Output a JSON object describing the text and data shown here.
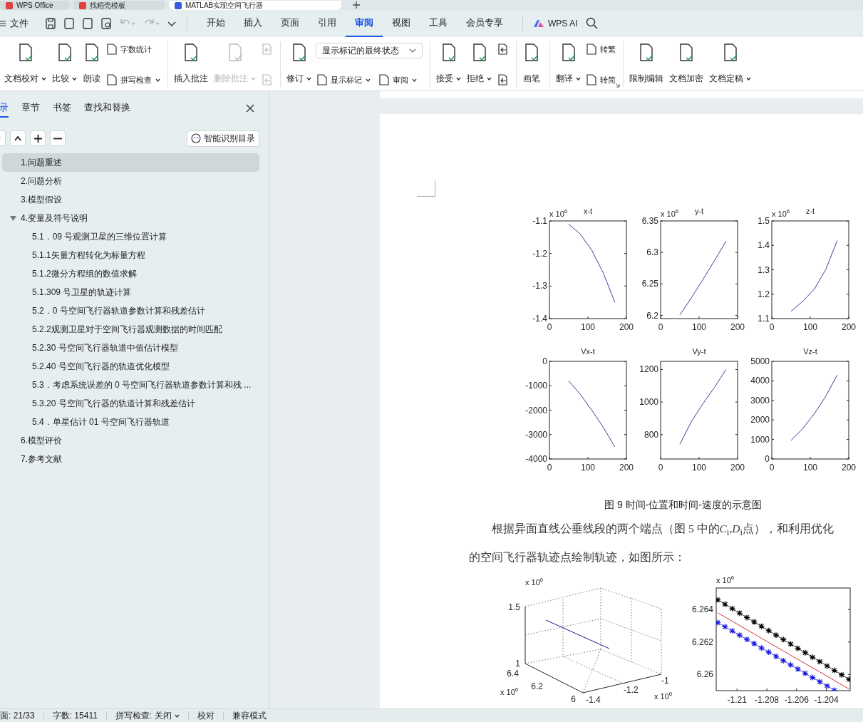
{
  "browser_tabs": [
    {
      "label": "WPS Office",
      "selected": false
    },
    {
      "label": "找稻壳模板",
      "selected": false
    },
    {
      "label": "MATLAB实现空间飞行器",
      "selected": true
    }
  ],
  "menu": {
    "file": "文件",
    "tabs": [
      {
        "label": "开始",
        "selected": false
      },
      {
        "label": "插入",
        "selected": false
      },
      {
        "label": "页面",
        "selected": false
      },
      {
        "label": "引用",
        "selected": false
      },
      {
        "label": "审阅",
        "selected": true
      },
      {
        "label": "视图",
        "selected": false
      },
      {
        "label": "工具",
        "selected": false
      },
      {
        "label": "会员专享",
        "selected": false
      }
    ],
    "ai": "WPS AI"
  },
  "ribbon": {
    "groups": [
      {
        "items": [
          {
            "kind": "big",
            "label": "文档校对",
            "caret": true,
            "disabled": false
          },
          {
            "kind": "big",
            "label": "比较",
            "caret": true,
            "disabled": false
          },
          {
            "kind": "big",
            "label": "朗读",
            "disabled": false
          },
          {
            "kind": "stack",
            "items": [
              {
                "kind": "small",
                "label": "字数统计",
                "disabled": false
              },
              {
                "kind": "small",
                "label": "拼写检查",
                "caret": true,
                "disabled": false
              }
            ]
          }
        ]
      },
      {
        "items": [
          {
            "kind": "big",
            "label": "插入批注",
            "disabled": false
          },
          {
            "kind": "big",
            "label": "删除批注",
            "caret": true,
            "disabled": true
          },
          {
            "kind": "stack",
            "items": [
              {
                "kind": "icon",
                "disabled": true
              },
              {
                "kind": "icon",
                "disabled": true
              }
            ]
          }
        ]
      },
      {
        "items": [
          {
            "kind": "big",
            "label": "修订",
            "caret": true,
            "disabled": false
          },
          {
            "kind": "stack",
            "items": [
              {
                "kind": "select",
                "label": "显示标记的最终状态"
              },
              {
                "kind": "pair",
                "items": [
                  {
                    "label": "显示标记",
                    "caret": true,
                    "disabled": false
                  },
                  {
                    "label": "审阅",
                    "caret": true,
                    "disabled": false
                  }
                ]
              }
            ]
          }
        ]
      },
      {
        "items": [
          {
            "kind": "big",
            "label": "接受",
            "caret": true,
            "disabled": false
          },
          {
            "kind": "big",
            "label": "拒绝",
            "caret": true,
            "disabled": false
          },
          {
            "kind": "stack",
            "items": [
              {
                "kind": "icon",
                "disabled": false
              },
              {
                "kind": "icon",
                "disabled": false
              }
            ]
          }
        ]
      },
      {
        "items": [
          {
            "kind": "big",
            "label": "画笔",
            "disabled": false
          }
        ]
      },
      {
        "launcher": true,
        "items": [
          {
            "kind": "big",
            "label": "翻译",
            "caret": true,
            "disabled": false
          },
          {
            "kind": "stack",
            "items": [
              {
                "kind": "small",
                "label": "转繁",
                "disabled": false
              },
              {
                "kind": "small",
                "label": "转简",
                "disabled": false
              }
            ]
          }
        ]
      },
      {
        "items": [
          {
            "kind": "big",
            "label": "限制编辑",
            "disabled": false
          },
          {
            "kind": "big",
            "label": "文档加密",
            "disabled": false
          },
          {
            "kind": "big",
            "label": "文档定稿",
            "caret": true,
            "disabled": false
          }
        ]
      }
    ]
  },
  "sidebar": {
    "tabs": [
      {
        "label": "录",
        "selected": true
      },
      {
        "label": "章节",
        "selected": false
      },
      {
        "label": "书签",
        "selected": false
      },
      {
        "label": "查找和替换",
        "selected": false
      }
    ],
    "smart_button": "智能识别目录",
    "outline": [
      {
        "label": "1.问题重述",
        "selected": true
      },
      {
        "label": "2.问题分析",
        "selected": false
      },
      {
        "label": "3.模型假设",
        "selected": false
      },
      {
        "label": "4.变量及符号说明",
        "selected": false,
        "expanded": true,
        "children": [
          {
            "label": "5.1．09 号观测卫星的三维位置计算",
            "selected": false
          },
          {
            "label": "5.1.1矢量方程转化为标量方程",
            "selected": false
          },
          {
            "label": "5.1.2微分方程组的数值求解",
            "selected": false
          },
          {
            "label": "5.1.309 号卫星的轨迹计算",
            "selected": false
          },
          {
            "label": "5.2．0 号空间飞行器轨道参数计算和残差估计",
            "selected": false
          },
          {
            "label": "5.2.2观测卫星对于空间飞行器观测数据的时间匹配",
            "selected": false
          },
          {
            "label": "5.2.30 号空间飞行器轨道中值估计模型",
            "selected": false
          },
          {
            "label": "5.2.40 号空间飞行器的轨道优化模型",
            "selected": false
          },
          {
            "label": "5.3．考虑系统误差的 0 号空间飞行器轨道参数计算和残 ...",
            "selected": false
          },
          {
            "label": "5.3.20 号空间飞行器的轨道计算和残差估计",
            "selected": false
          },
          {
            "label": "5.4．单星估计 01 号空间飞行器轨道",
            "selected": false
          }
        ]
      },
      {
        "label": "6.模型评价",
        "selected": false
      },
      {
        "label": "7.参考文献",
        "selected": false
      }
    ]
  },
  "document": {
    "subplots": [
      {
        "chart_data": {
          "type": "line",
          "title": "x-t",
          "annotations": [
            {
              "text": "x 10$^{6}$"
            }
          ],
          "xlim": [
            0,
            200
          ],
          "ylim": [
            -1.4,
            -1.1
          ],
          "xticks": [
            0,
            100,
            200
          ],
          "yticks": [
            -1.1,
            -1.2,
            -1.3,
            -1.4
          ],
          "x": [
            50,
            80,
            110,
            140,
            170
          ],
          "series": [
            {
              "color": "#3c3c9a",
              "values": [
                -1.11,
                -1.14,
                -1.19,
                -1.26,
                -1.35
              ]
            }
          ]
        }
      },
      {
        "chart_data": {
          "type": "line",
          "title": "y-t",
          "annotations": [
            {
              "text": "x 10$^{6}$"
            }
          ],
          "xlim": [
            0,
            200
          ],
          "ylim": [
            6.195,
            6.35
          ],
          "xticks": [
            0,
            100,
            200
          ],
          "yticks": [
            6.35,
            6.3,
            6.25,
            6.2
          ],
          "x": [
            50,
            80,
            110,
            140,
            170
          ],
          "series": [
            {
              "color": "#3c3c9a",
              "values": [
                6.201,
                6.228,
                6.257,
                6.287,
                6.318
              ]
            }
          ]
        }
      },
      {
        "chart_data": {
          "type": "line",
          "title": "z-t",
          "annotations": [
            {
              "text": "x 10$^{6}$"
            }
          ],
          "xlim": [
            0,
            200
          ],
          "ylim": [
            1.1,
            1.5
          ],
          "xticks": [
            0,
            100,
            200
          ],
          "yticks": [
            1.5,
            1.4,
            1.3,
            1.2,
            1.1
          ],
          "x": [
            50,
            80,
            110,
            140,
            170
          ],
          "series": [
            {
              "color": "#3c3c9a",
              "values": [
                1.13,
                1.17,
                1.22,
                1.3,
                1.42
              ]
            }
          ]
        }
      },
      {
        "chart_data": {
          "type": "line",
          "title": "Vx-t",
          "xlim": [
            0,
            200
          ],
          "ylim": [
            -4000,
            0
          ],
          "xticks": [
            0,
            100,
            200
          ],
          "yticks": [
            0,
            -1000,
            -2000,
            -3000,
            -4000
          ],
          "x": [
            50,
            80,
            110,
            140,
            170
          ],
          "series": [
            {
              "color": "#3c3c9a",
              "values": [
                -800,
                -1350,
                -2000,
                -2700,
                -3500
              ]
            }
          ]
        }
      },
      {
        "chart_data": {
          "type": "line",
          "title": "Vy-t",
          "xlim": [
            0,
            200
          ],
          "ylim": [
            650,
            1250
          ],
          "xticks": [
            0,
            100,
            200
          ],
          "yticks": [
            1200,
            1000,
            800
          ],
          "x": [
            50,
            80,
            110,
            140,
            170
          ],
          "series": [
            {
              "color": "#3c3c9a",
              "values": [
                740,
                880,
                990,
                1090,
                1200
              ]
            }
          ]
        }
      },
      {
        "chart_data": {
          "type": "line",
          "title": "Vz-t",
          "xlim": [
            0,
            200
          ],
          "ylim": [
            0,
            5000
          ],
          "xticks": [
            0,
            100,
            200
          ],
          "yticks": [
            5000,
            4000,
            3000,
            2000,
            1000,
            0
          ],
          "x": [
            50,
            80,
            110,
            140,
            170
          ],
          "series": [
            {
              "color": "#3c3c9a",
              "values": [
                950,
                1550,
                2300,
                3200,
                4300
              ]
            }
          ]
        }
      }
    ],
    "caption": "图 9 时间-位置和时间-速度的示意图",
    "paragraph_lines": [
      [
        {
          "text": "根据异面直线公垂线段的两个端点（图 5 中的"
        },
        {
          "text": "C",
          "italic": true
        },
        {
          "text": "$_{i}$,"
        },
        {
          "text": "D",
          "italic": true
        },
        {
          "text": "$_{i}$点），和利用优化"
        }
      ],
      [
        {
          "text": "的空间飞行器轨迹点绘制轨迹，如图所示："
        }
      ]
    ],
    "plot_3d": {
      "z_multiplier": "x 10$^{6}$",
      "z_ticks": [
        "1.5",
        "1"
      ],
      "y_multiplier": "x 10$^{6}$",
      "y_ticks": [
        "6.4",
        "6.2",
        "6"
      ],
      "x_multiplier": "x 10$^{6}$",
      "x_ticks": [
        "-1.4",
        "-1.2",
        "-1"
      ]
    },
    "zoom_plot": {
      "chart_data": {
        "type": "line",
        "annotations": [
          {
            "text": "x 10$^{6}$"
          }
        ],
        "xlim": [
          -1.2114,
          -1.2024
        ],
        "ylim": [
          6.259,
          6.26533
        ],
        "xticks": [
          -1.21,
          -1.208,
          -1.206,
          -1.204
        ],
        "yticks": [
          6.264,
          6.262,
          6.26
        ],
        "x": [
          -1.2113,
          -1.21081,
          -1.21032,
          -1.20983,
          -1.20934,
          -1.20885,
          -1.20836,
          -1.20787,
          -1.20738,
          -1.20689,
          -1.2064,
          -1.20591,
          -1.20542,
          -1.20493,
          -1.20444,
          -1.20395,
          -1.20346,
          -1.20297,
          -1.20248
        ],
        "series": [
          {
            "color": "#000000",
            "marker": "cross",
            "values": [
              6.2646,
              6.26433,
              6.26406,
              6.26378,
              6.26351,
              6.26324,
              6.26297,
              6.2627,
              6.26242,
              6.26215,
              6.26188,
              6.26161,
              6.26134,
              6.26106,
              6.26079,
              6.26052,
              6.26025,
              6.25998,
              6.2597
            ]
          },
          {
            "color": "#d03030",
            "values": [
              6.2638,
              6.26354,
              6.26328,
              6.26302,
              6.26276,
              6.2625,
              6.26223,
              6.26197,
              6.26171,
              6.26145,
              6.26119,
              6.26093,
              6.26067,
              6.26041,
              6.26015,
              6.25989,
              6.25962,
              6.25936,
              6.2591
            ]
          },
          {
            "color": "#1a1ae0",
            "marker": "cross",
            "values": [
              6.2632,
              6.26294,
              6.26268,
              6.26242,
              6.26216,
              6.2619,
              6.26163,
              6.26137,
              6.26111,
              6.26085,
              6.26059,
              6.26033,
              6.26007,
              6.25981,
              6.25955,
              6.25929,
              6.25902,
              null,
              null
            ]
          }
        ]
      }
    }
  },
  "status_bar": [
    {
      "label": "面: 21/33"
    },
    {
      "label": "字数: 15411"
    },
    {
      "label": "拼写检查: 关闭",
      "caret": true
    },
    {
      "label": "校对"
    },
    {
      "label": "兼容模式"
    }
  ]
}
